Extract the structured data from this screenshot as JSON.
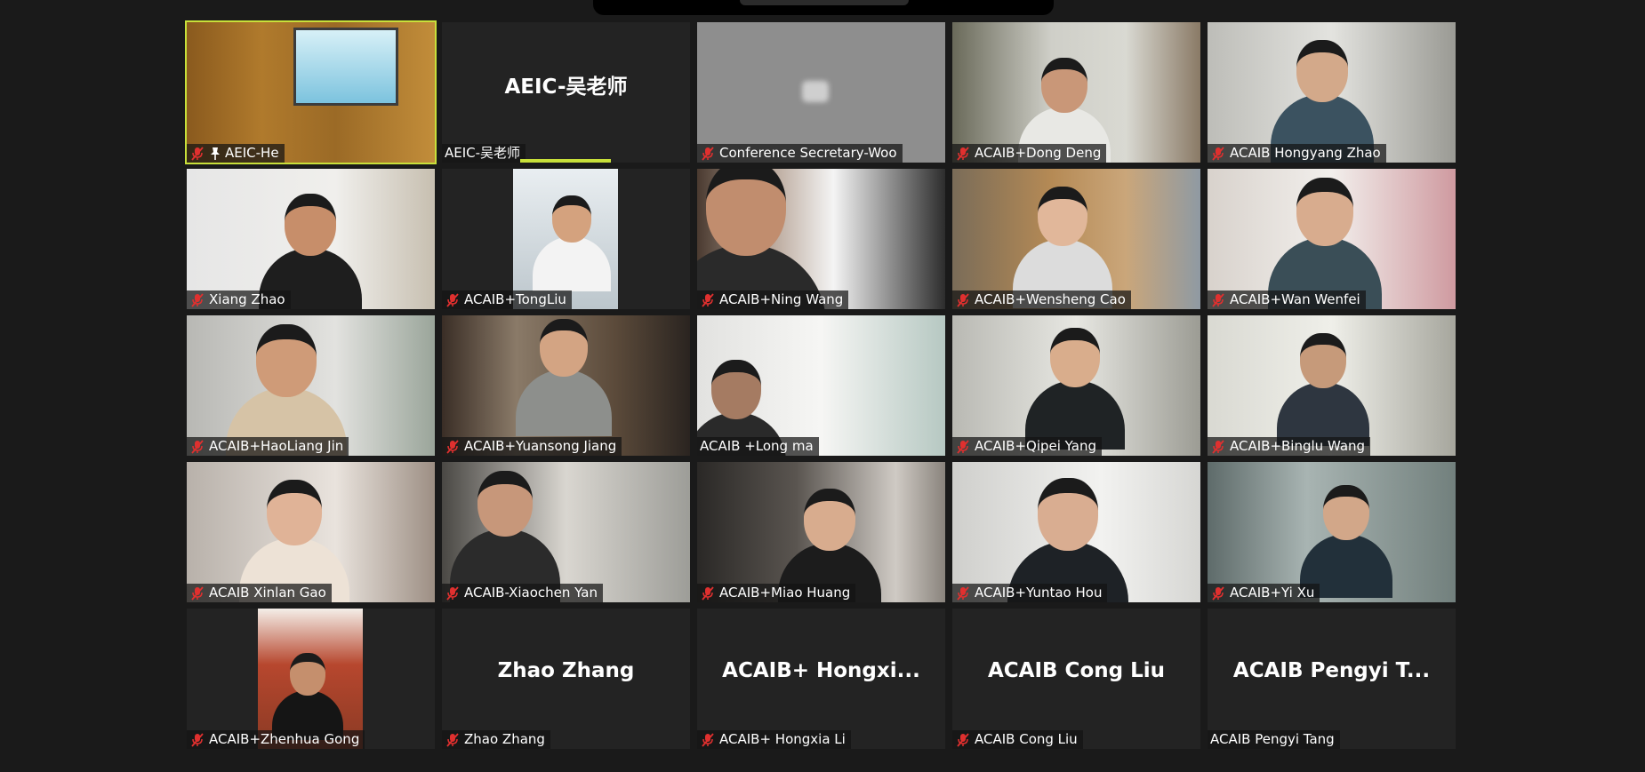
{
  "meeting": {
    "participants": [
      {
        "name": "AEIC-He",
        "muted": true,
        "pinned": true,
        "video": true,
        "active": true
      },
      {
        "name": "AEIC-吴老师",
        "muted": false,
        "video": false,
        "avatar": "AEIC-吴老师",
        "speaking": true
      },
      {
        "name": "Conference Secretary-Woo",
        "muted": true,
        "video": true
      },
      {
        "name": "ACAIB+Dong Deng",
        "muted": true,
        "video": true
      },
      {
        "name": "ACAIB Hongyang Zhao",
        "muted": true,
        "video": true
      },
      {
        "name": "Xiang Zhao",
        "muted": true,
        "video": true
      },
      {
        "name": "ACAIB+TongLiu",
        "muted": true,
        "video": true,
        "inset": true
      },
      {
        "name": "ACAIB+Ning Wang",
        "muted": true,
        "video": true
      },
      {
        "name": "ACAIB+Wensheng Cao",
        "muted": true,
        "video": true
      },
      {
        "name": "ACAIB+Wan Wenfei",
        "muted": true,
        "video": true
      },
      {
        "name": "ACAIB+HaoLiang Jin",
        "muted": true,
        "video": true
      },
      {
        "name": "ACAIB+Yuansong Jiang",
        "muted": true,
        "video": true
      },
      {
        "name": "ACAIB +Long ma",
        "muted": false,
        "video": true
      },
      {
        "name": "ACAIB+Qipei Yang",
        "muted": true,
        "video": true
      },
      {
        "name": "ACAIB+Binglu Wang",
        "muted": true,
        "video": true
      },
      {
        "name": "ACAIB Xinlan Gao",
        "muted": true,
        "video": true
      },
      {
        "name": "ACAIB-Xiaochen Yan",
        "muted": true,
        "video": true
      },
      {
        "name": "ACAIB+Miao Huang",
        "muted": true,
        "video": true
      },
      {
        "name": "ACAIB+Yuntao Hou",
        "muted": true,
        "video": true
      },
      {
        "name": "ACAIB+Yi Xu",
        "muted": true,
        "video": true
      },
      {
        "name": "ACAIB+Zhenhua Gong",
        "muted": true,
        "video": true,
        "inset": true
      },
      {
        "name": "Zhao Zhang",
        "muted": true,
        "video": false,
        "avatar": "Zhao Zhang"
      },
      {
        "name": "ACAIB+ Hongxia Li",
        "muted": true,
        "video": false,
        "avatar": "ACAIB+  Hongxi..."
      },
      {
        "name": "ACAIB Cong Liu",
        "muted": true,
        "video": false,
        "avatar": "ACAIB Cong Liu"
      },
      {
        "name": "ACAIB Pengyi Tang",
        "muted": false,
        "video": false,
        "avatar": "ACAIB  Pengyi  T..."
      }
    ]
  },
  "icons": {
    "mute": "mic-muted-icon",
    "pin": "pin-icon"
  },
  "colors": {
    "active_border": "#c8e03a",
    "mute_red": "#e0302f",
    "background": "#1a1a1a",
    "tile": "#232323"
  }
}
